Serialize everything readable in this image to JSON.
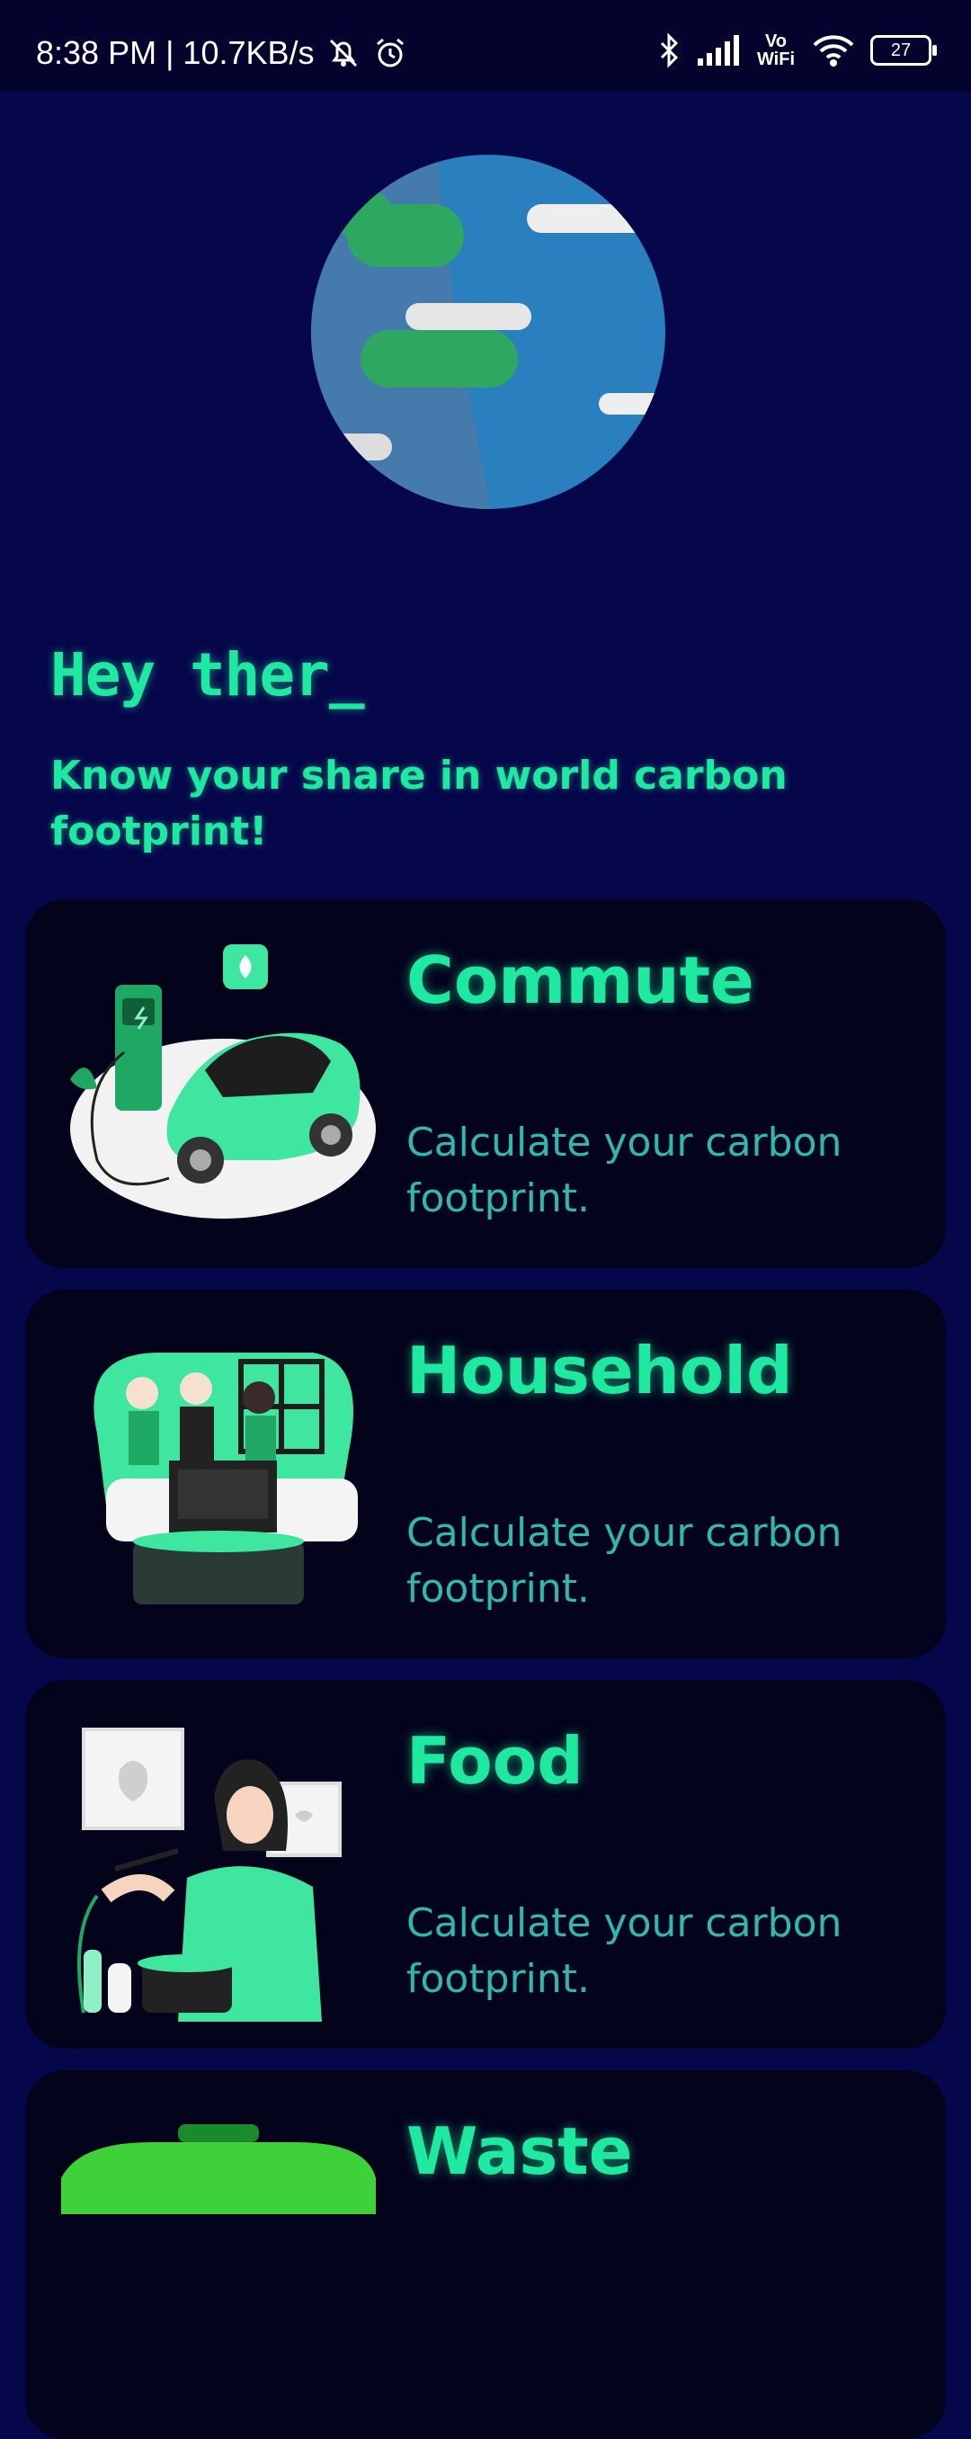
{
  "status_bar": {
    "time_speed": "8:38 PM | 10.7KB/s",
    "network_label": "Vo WiFi",
    "battery": "27"
  },
  "hero": {
    "greeting": "Hey ther_",
    "subtitle": "Know your share in world carbon footprint!"
  },
  "categories": [
    {
      "title": "Commute",
      "description": "Calculate your carbon footprint."
    },
    {
      "title": "Household",
      "description": "Calculate your carbon footprint."
    },
    {
      "title": "Food",
      "description": "Calculate your carbon footprint."
    },
    {
      "title": "Waste",
      "description": ""
    }
  ],
  "colors": {
    "background": "#06064a",
    "card": "#03031c",
    "accent": "#1de9a0",
    "muted_accent": "#2fb8b0"
  }
}
